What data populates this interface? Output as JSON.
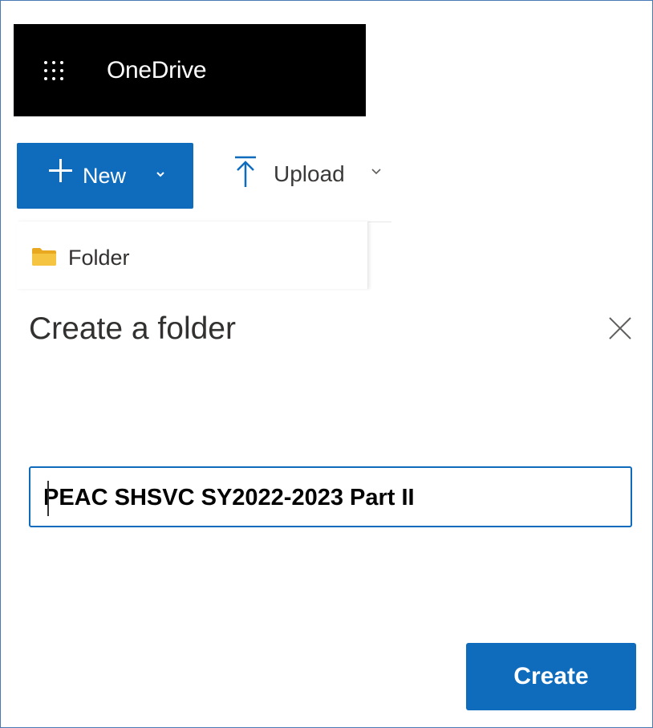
{
  "header": {
    "app_title": "OneDrive",
    "launcher_icon": "app-launcher-waffle-icon",
    "background": "#000000"
  },
  "command_bar": {
    "new_label": "New",
    "new_icon": "plus-icon",
    "new_chevron_icon": "chevron-down-icon",
    "upload_label": "Upload",
    "upload_icon": "upload-arrow-icon",
    "upload_chevron_icon": "chevron-down-icon",
    "accent": "#0f6cbd"
  },
  "new_menu": {
    "items": [
      {
        "label": "Folder",
        "icon": "folder-icon",
        "icon_color": "#f5c542"
      }
    ]
  },
  "dialog": {
    "title": "Create a folder",
    "close_icon": "close-icon",
    "folder_name_value": "PEAC SHSVC SY2022-2023 Part II",
    "create_label": "Create"
  }
}
